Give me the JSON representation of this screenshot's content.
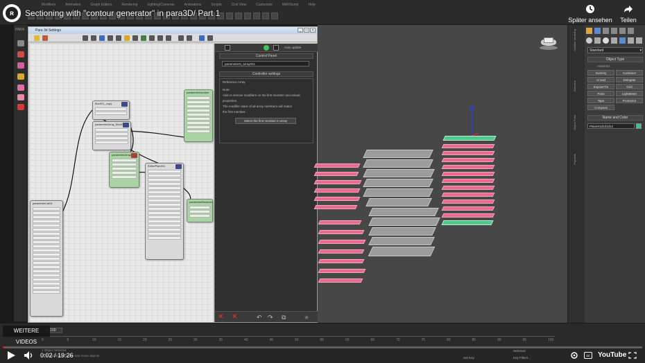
{
  "video": {
    "title": "Sectioning with \"contour generator\" in para3D/ Part 1",
    "time_current": "0:02",
    "time_total": "19:26",
    "time_display": "0:02 / 19:26",
    "progress_fraction": 0.002,
    "watch_later_label": "Später ansehen",
    "share_label": "Teilen",
    "more_videos_label": "WEITERE VIDEOS",
    "youtube_label": "YouTube"
  },
  "app": {
    "menu": [
      "Modifiers",
      "Animation",
      "Graph Editors",
      "Rendering",
      "Lighting/Cameras",
      "Animations",
      "Scripts",
      "Civil View",
      "Customize",
      "MAXScript",
      "Help"
    ],
    "side_label": "PARA"
  },
  "node_editor": {
    "window_title": "Para 3d Settings",
    "nodes": [
      {
        "title": "Box001_copy",
        "color": "grey"
      },
      {
        "title": "parameterArray_Box03",
        "color": "grey"
      },
      {
        "title": "parameterArray001",
        "color": "green"
      },
      {
        "title": "parameterTransforms",
        "color": "grey"
      },
      {
        "title": "parameterNumber",
        "color": "green"
      },
      {
        "title": "parameterBoolean",
        "color": "green"
      },
      {
        "title": "parameterList01",
        "color": "grey"
      },
      {
        "title": "EditorPlane01",
        "color": "grey"
      }
    ]
  },
  "control_panel": {
    "header": "Control Panel",
    "auto_update": "Auto update",
    "array_field": "parameterN_array001",
    "settings_header": "Controller settings",
    "reference_label": "Reference Array",
    "note_lines": [
      "Note:",
      "Add or remove modifiers on the first member and reload",
      "properties.",
      "The modifier stack of all array members will match",
      "the first member."
    ],
    "select_button": "Select the first member in array"
  },
  "command_panel": {
    "dropdown": "Standard",
    "object_type_title": "Object Type",
    "autogrid": "AutoGrid",
    "buttons": [
      "Dummy",
      "Container",
      "Crowd",
      "Delegate",
      "ExposeTm",
      "Grid",
      "Point",
      "LightMeter",
      "Tape",
      "Protractor",
      "Compass"
    ],
    "name_color_title": "Name and Color",
    "name_field": "Plane01d1d1d12",
    "swatch_color": "#3cc48a",
    "vertical_tabs": [
      "Modifier Modeling",
      "Selection",
      "Object Paint",
      "Populate"
    ]
  },
  "timeline": {
    "frame_display": "0 / 100",
    "ticks": [
      "0",
      "5",
      "10",
      "15",
      "20",
      "25",
      "30",
      "35",
      "40",
      "45",
      "50",
      "55",
      "60",
      "65",
      "70",
      "75",
      "80",
      "85",
      "90",
      "95",
      "100"
    ],
    "status_text": "1 Object Selected",
    "hint_text": "Click and drag to select and move objects",
    "autokey": "Selected",
    "set_key": "Set Key",
    "key_filters": "Key Filters..."
  },
  "colors": {
    "accent_pink": "#e66b8c",
    "accent_green": "#4fc78c",
    "yt_red": "#ff0000"
  }
}
